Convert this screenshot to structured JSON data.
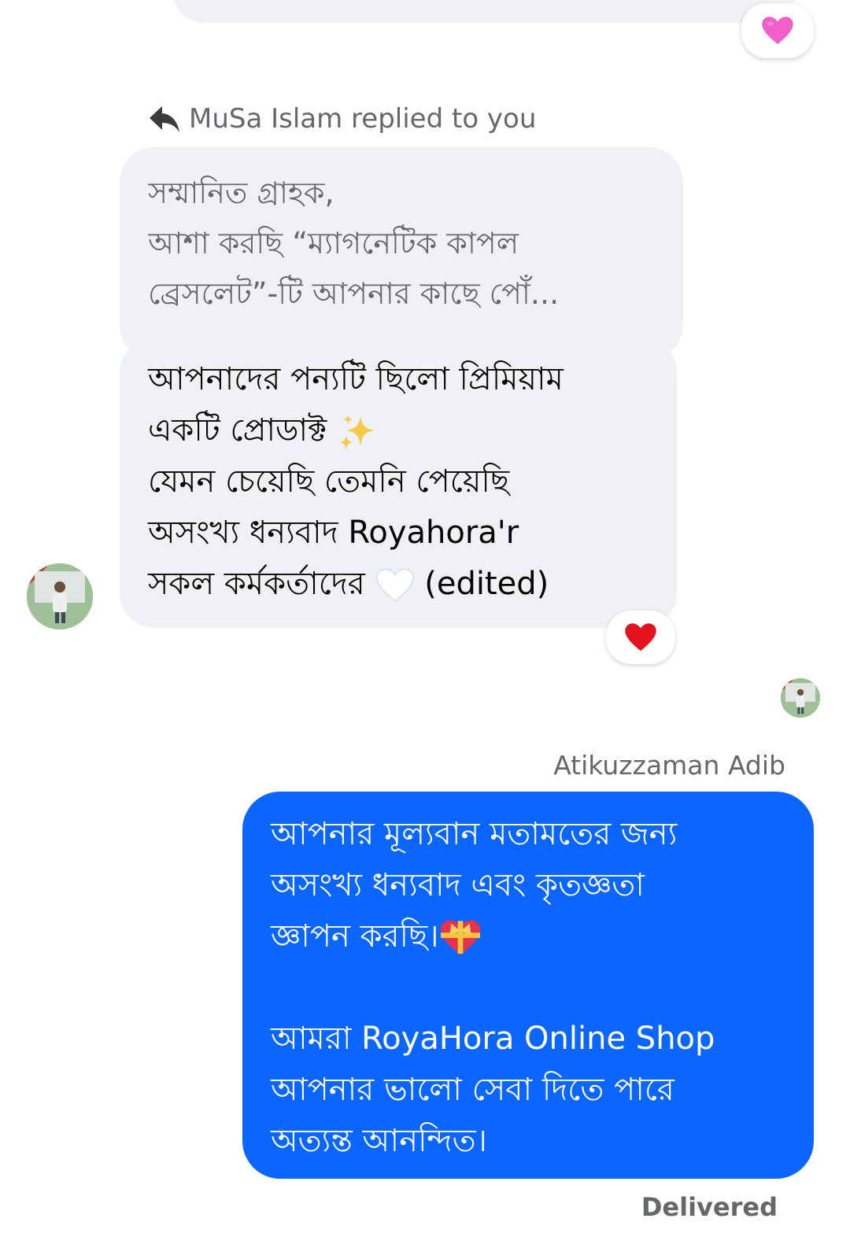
{
  "reactions": {
    "top_reaction": "pink-heart",
    "mid_reaction": "red-heart"
  },
  "reply": {
    "header_text": "MuSa Islam replied to you",
    "quoted_lines": [
      "সম্মানিত গ্রাহক,",
      "আশা করছি “ম্যাগনেটিক কাপল",
      "ব্রেসলেট”-টি আপনার কাছে পোঁ..."
    ],
    "message_lines": [
      "আপনাদের পন্যটি ছিলো প্রিমিয়াম",
      "একটি প্রোডাক্ট",
      "যেমন চেয়েছি তেমনি পেয়েছি",
      "অসংখ্য ধন্যবাদ Royahora'r",
      "সকল কর্মকর্তাদের"
    ],
    "edited_label": "(edited)"
  },
  "outgoing": {
    "sender_name": "Atikuzzaman Adib",
    "lines": [
      "আপনার মূল্যবান মতামতের জন্য",
      "অসংখ্য ধন্যবাদ এবং কৃতজ্ঞতা",
      "জ্ঞাপন করছি।",
      "",
      "আমরা RoyaHora Online Shop",
      "আপনার ভালো সেবা দিতে পারে",
      "অত্যন্ত আনন্দিত।"
    ],
    "status": "Delivered"
  },
  "colors": {
    "incoming_bubble": "#f0f1f4",
    "outgoing_bubble": "#0a66ff",
    "secondary_text": "#65676b"
  }
}
